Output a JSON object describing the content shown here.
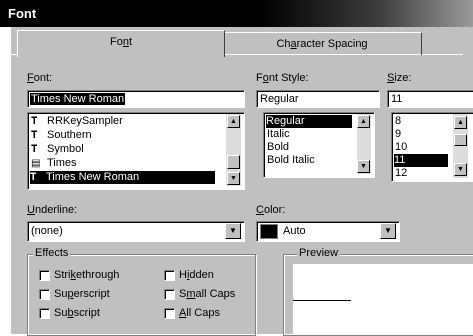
{
  "window": {
    "title": "Font"
  },
  "tabs": [
    {
      "label_pre": "Fo",
      "label_u": "n",
      "label_post": "t"
    },
    {
      "label_pre": "Ch",
      "label_u": "a",
      "label_post": "racter Spacing"
    }
  ],
  "font": {
    "label_u": "F",
    "label_post": "ont:",
    "value": "Times New Roman",
    "items": [
      {
        "icon": "TT",
        "label": "RRKeySampler"
      },
      {
        "icon": "TT",
        "label": "Southern"
      },
      {
        "icon": "TT",
        "label": "Symbol"
      },
      {
        "icon": "printer",
        "label": "Times"
      },
      {
        "icon": "TT",
        "label": "Times New Roman"
      }
    ]
  },
  "style": {
    "label_pre": "F",
    "label_u": "o",
    "label_post": "nt Style:",
    "value": "Regular",
    "items": [
      "Regular",
      "Italic",
      "Bold",
      "Bold Italic"
    ]
  },
  "size": {
    "label_u": "S",
    "label_post": "ize:",
    "value": "11",
    "items": [
      "8",
      "9",
      "10",
      "11",
      "12"
    ]
  },
  "underline": {
    "label_u": "U",
    "label_post": "nderline:",
    "value": "(none)"
  },
  "color": {
    "label_u": "C",
    "label_post": "olor:",
    "value": "Auto",
    "swatch": "#000000"
  },
  "effects": {
    "title": "Effects",
    "items": [
      {
        "pre": "Stri",
        "u": "k",
        "post": "ethrough"
      },
      {
        "pre": "Su",
        "u": "p",
        "post": "erscript"
      },
      {
        "pre": "Su",
        "u": "b",
        "post": "script"
      },
      {
        "pre": "H",
        "u": "i",
        "post": "dden"
      },
      {
        "pre": "S",
        "u": "m",
        "post": "all Caps"
      },
      {
        "pre": "",
        "u": "A",
        "post": "ll Caps"
      }
    ]
  },
  "preview": {
    "title": "Preview"
  }
}
